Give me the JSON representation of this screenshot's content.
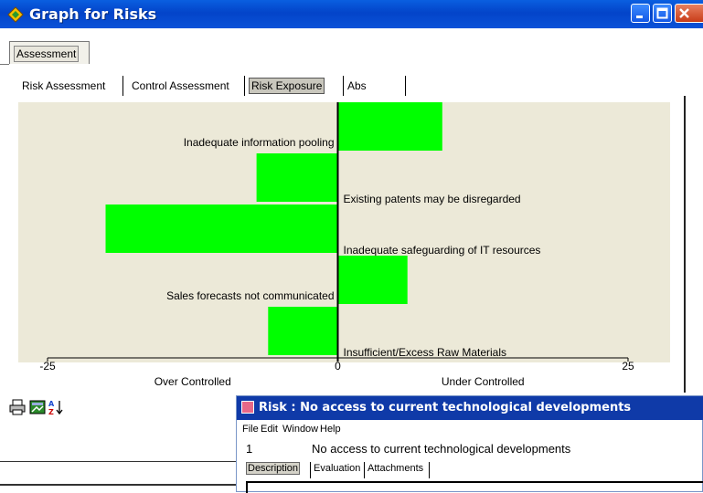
{
  "window": {
    "title": "Graph for Risks"
  },
  "outer_tab": {
    "label": "Assessment"
  },
  "sub_tabs": [
    {
      "label": "Risk Assessment",
      "selected": false
    },
    {
      "label": "Control Assessment",
      "selected": false
    },
    {
      "label": "Risk Exposure",
      "selected": true
    },
    {
      "label": "Abs",
      "selected": false
    }
  ],
  "chart_data": {
    "type": "bar",
    "orientation": "horizontal",
    "categories": [
      "Inadequate information pooling",
      "Existing patents may be disregarded",
      "Inadequate safeguarding of IT resources",
      "Sales forecasts not communicated",
      "Insufficient/Excess Raw Materials"
    ],
    "values": [
      9,
      -7,
      -20,
      6,
      -6
    ],
    "xlim": [
      -25,
      25
    ],
    "ticks": [
      "-25",
      "0",
      "25"
    ],
    "left_label": "Over Controlled",
    "right_label": "Under Controlled",
    "bar_color": "#00ff00",
    "background": "#ece9d8"
  },
  "toolbar": {
    "icons": [
      "printer-icon",
      "export-chart-icon",
      "sort-az-icon"
    ]
  },
  "risk_window": {
    "title": "Risk : No access to current technological developments",
    "menu": [
      "File",
      "Edit",
      "Window",
      "Help"
    ],
    "id": "1",
    "name": "No access to current technological developments",
    "tabs": [
      "Description",
      "Evaluation",
      "Attachments"
    ]
  },
  "colors": {
    "titlebar": "#0a52d8",
    "subtitlebar": "#0f3aa8",
    "bar": "#00ff00"
  }
}
